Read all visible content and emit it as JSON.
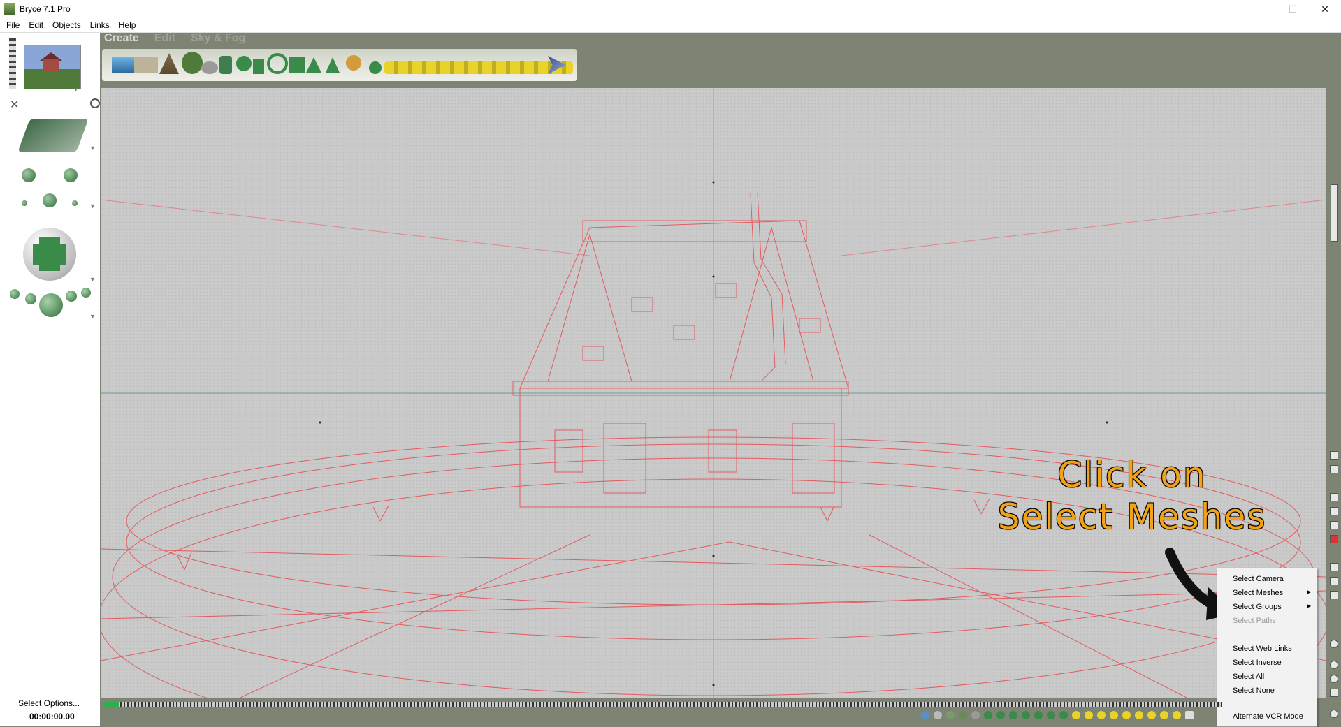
{
  "window": {
    "title": "Bryce 7.1  Pro",
    "minimize": "—",
    "maximize": "☐",
    "close": "✕"
  },
  "menu": [
    "File",
    "Edit",
    "Objects",
    "Links",
    "Help"
  ],
  "palette_tabs": [
    "Create",
    "Edit",
    "Sky & Fog"
  ],
  "left_panel": {
    "status_label": "Select Options...",
    "time": "00:00:00.00"
  },
  "annotation": {
    "line1": "Click on",
    "line2": "Select Meshes"
  },
  "context_menu": {
    "items": [
      {
        "label": "Select Camera",
        "submenu": false,
        "enabled": true
      },
      {
        "label": "Select Meshes",
        "submenu": true,
        "enabled": true
      },
      {
        "label": "Select Groups",
        "submenu": true,
        "enabled": true
      },
      {
        "label": "Select Paths",
        "submenu": false,
        "enabled": false
      },
      {
        "label": "Select Web Links",
        "submenu": false,
        "enabled": true
      },
      {
        "label": "Select Inverse",
        "submenu": false,
        "enabled": true
      },
      {
        "label": "Select All",
        "submenu": false,
        "enabled": true
      },
      {
        "label": "Select None",
        "submenu": false,
        "enabled": true
      },
      {
        "label": "Alternate VCR Mode",
        "submenu": false,
        "enabled": true
      }
    ]
  },
  "colors": {
    "wireframe": "#e8474c",
    "annotation": "#f1a216",
    "background": "#7e8474"
  }
}
